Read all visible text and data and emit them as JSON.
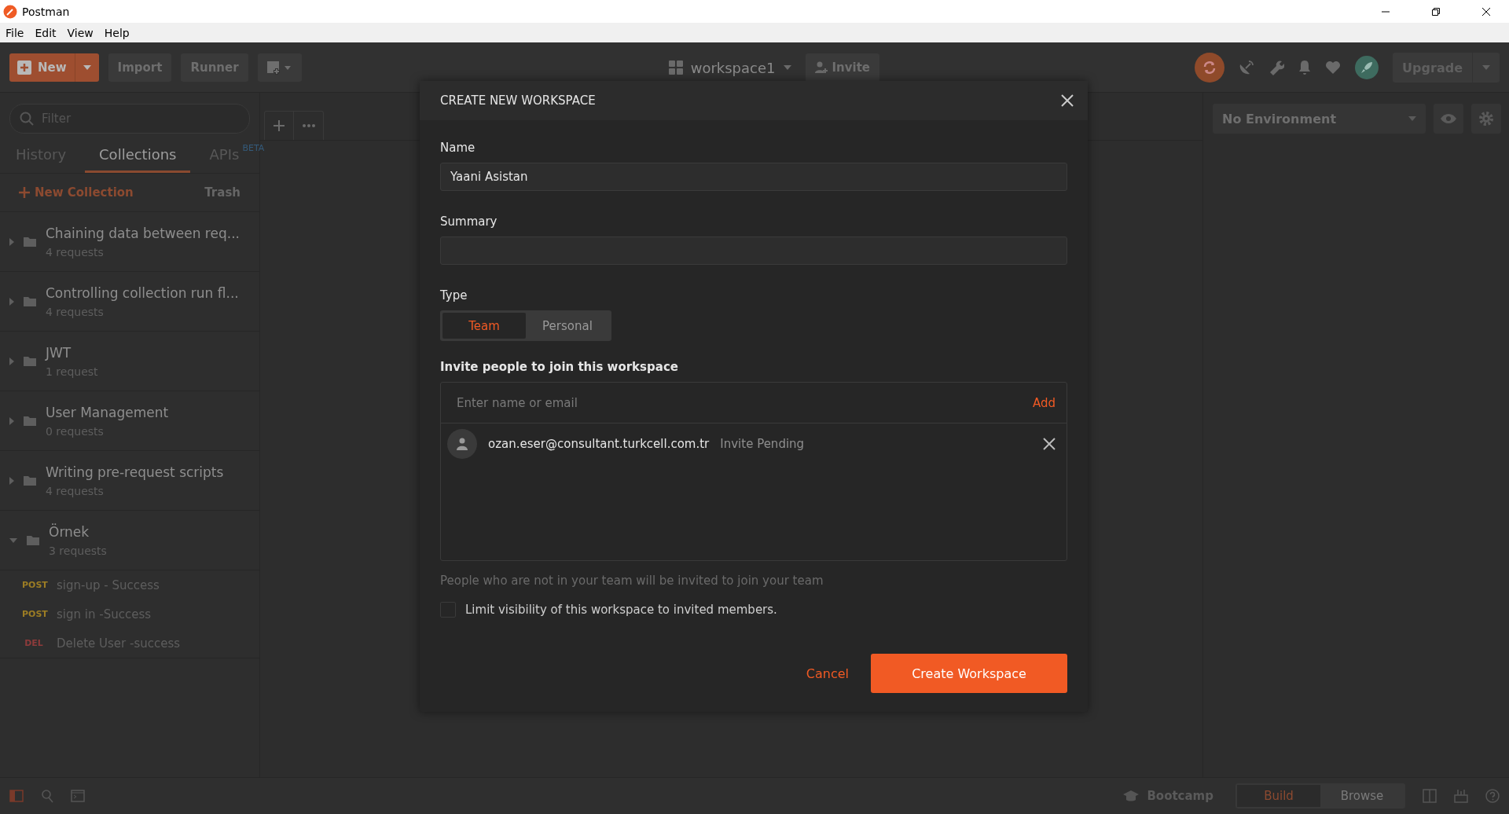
{
  "window": {
    "title": "Postman"
  },
  "menu": [
    "File",
    "Edit",
    "View",
    "Help"
  ],
  "toolbar": {
    "new": "New",
    "import": "Import",
    "runner": "Runner",
    "workspace": "workspace1",
    "invite": "Invite",
    "upgrade": "Upgrade"
  },
  "sidebar": {
    "filter_placeholder": "Filter",
    "tabs": [
      {
        "label": "History",
        "selected": false
      },
      {
        "label": "Collections",
        "selected": true
      },
      {
        "label": "APIs",
        "badge": "BETA",
        "selected": false
      }
    ],
    "new_collection": "New Collection",
    "trash": "Trash",
    "collections": [
      {
        "name": "Chaining data between req...",
        "count": "4 requests",
        "expanded": false
      },
      {
        "name": "Controlling collection run fl...",
        "count": "4 requests",
        "expanded": false
      },
      {
        "name": "JWT",
        "count": "1 request",
        "expanded": false
      },
      {
        "name": "User Management",
        "count": "0 requests",
        "expanded": false
      },
      {
        "name": "Writing pre-request scripts",
        "count": "4 requests",
        "expanded": false
      },
      {
        "name": "Örnek",
        "count": "3 requests",
        "expanded": true,
        "requests": [
          {
            "method": "POST",
            "color": "#9c7d24",
            "name": "sign-up - Success"
          },
          {
            "method": "POST",
            "color": "#9c7d24",
            "name": "sign in -Success"
          },
          {
            "method": "DEL",
            "color": "#8e3b3b",
            "name": "Delete User -success"
          }
        ]
      }
    ]
  },
  "environment": {
    "value": "No Environment"
  },
  "modal": {
    "title": "CREATE NEW WORKSPACE",
    "name_label": "Name",
    "name_value": "Yaani Asistan",
    "summary_label": "Summary",
    "type_label": "Type",
    "types": [
      {
        "label": "Team",
        "selected": true
      },
      {
        "label": "Personal",
        "selected": false
      }
    ],
    "invite_label": "Invite people to join this workspace",
    "invite_placeholder": "Enter name or email",
    "add": "Add",
    "invitees": [
      {
        "email": "ozan.eser@consultant.turkcell.com.tr",
        "status": "Invite Pending"
      }
    ],
    "note": "People who are not in your team will be invited to join your team",
    "limit": {
      "label": "Limit visibility of this workspace to invited members.",
      "checked": false
    },
    "cancel": "Cancel",
    "create": "Create Workspace"
  },
  "status_bar": {
    "bootcamp": "Bootcamp",
    "modes": [
      {
        "label": "Build",
        "selected": true
      },
      {
        "label": "Browse",
        "selected": false
      }
    ]
  }
}
